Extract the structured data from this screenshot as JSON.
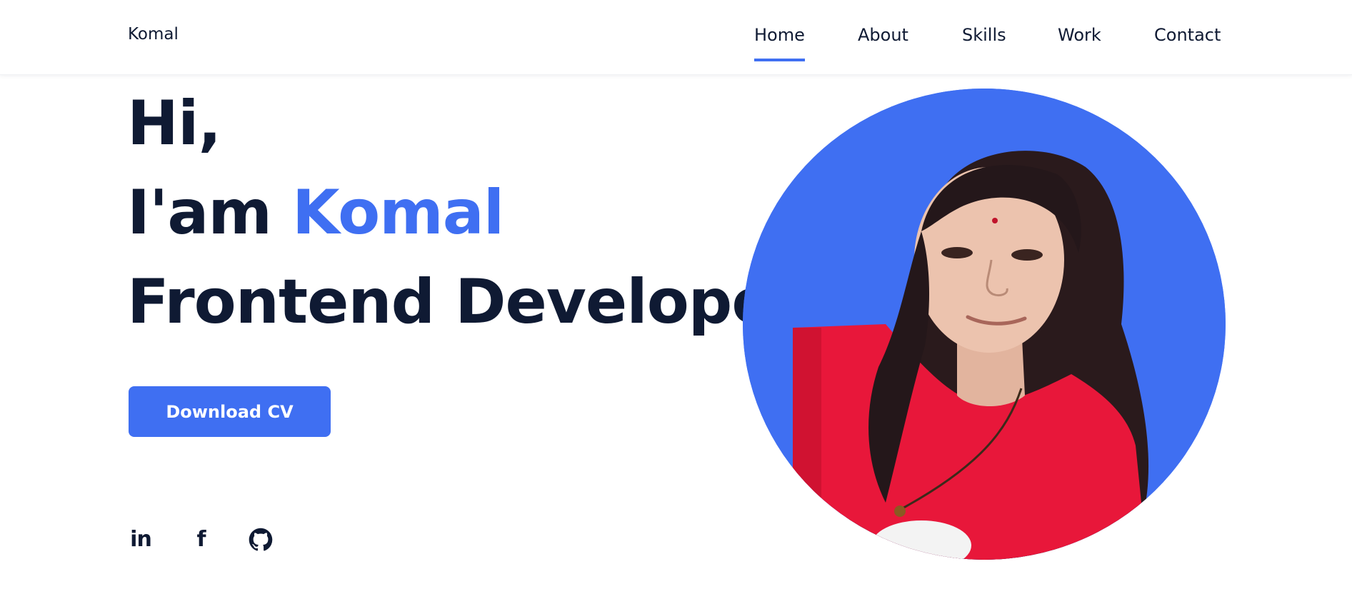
{
  "header": {
    "logo": "Komal",
    "nav": [
      {
        "label": "Home",
        "active": true
      },
      {
        "label": "About",
        "active": false
      },
      {
        "label": "Skills",
        "active": false
      },
      {
        "label": "Work",
        "active": false
      },
      {
        "label": "Contact",
        "active": false
      }
    ]
  },
  "hero": {
    "greeting": "Hi,",
    "intro_prefix": "I'am",
    "name": "Komal",
    "role": "Frontend Developer",
    "cv_button": "Download CV",
    "photo_alt": "Komal"
  },
  "social": [
    {
      "icon": "linkedin-icon",
      "label": "in"
    },
    {
      "icon": "facebook-icon",
      "label": "f"
    },
    {
      "icon": "github-icon"
    }
  ],
  "colors": {
    "accent": "#3f6ff2",
    "text": "#0f1a33",
    "background": "#ffffff",
    "shirt": "#e8173a"
  }
}
